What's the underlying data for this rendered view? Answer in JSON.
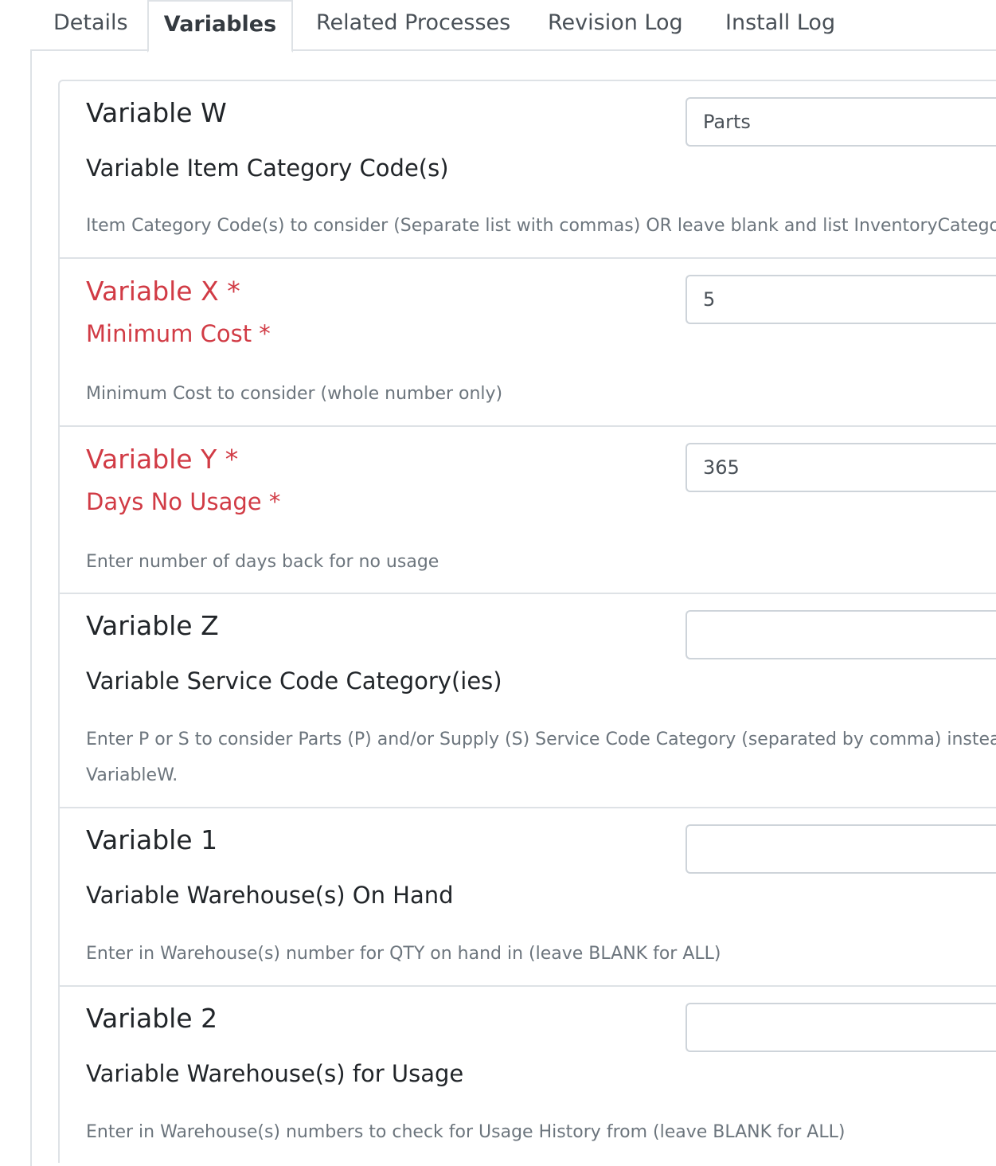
{
  "tabs": [
    {
      "label": "Details",
      "active": false
    },
    {
      "label": "Variables",
      "active": true
    },
    {
      "label": "Related Processes",
      "active": false
    },
    {
      "label": "Revision Log",
      "active": false
    },
    {
      "label": "Install Log",
      "active": false
    }
  ],
  "variables": [
    {
      "title": "Variable W",
      "subtitle": "Variable Item Category Code(s)",
      "description": "Item Category Code(s) to consider (Separate list with commas) OR leave blank and list InventoryCategoryCod",
      "value": "Parts",
      "required": false
    },
    {
      "title": "Variable X *",
      "subtitle": "Minimum Cost *",
      "description": "Minimum Cost to consider (whole number only)",
      "value": "5",
      "required": true
    },
    {
      "title": "Variable Y *",
      "subtitle": "Days No Usage *",
      "description": "Enter number of days back for no usage",
      "value": "365",
      "required": true
    },
    {
      "title": "Variable Z",
      "subtitle": "Variable Service Code Category(ies)",
      "description_line1": "Enter P or S to consider Parts (P) and/or Supply (S) Service Code Category (separated by comma) instead of I",
      "description_line2": "VariableW.",
      "value": "",
      "required": false
    },
    {
      "title": "Variable 1",
      "subtitle": "Variable Warehouse(s) On Hand",
      "description": "Enter in Warehouse(s) number for QTY on hand in (leave BLANK for ALL)",
      "value": "",
      "required": false
    },
    {
      "title": "Variable 2",
      "subtitle": "Variable Warehouse(s) for Usage",
      "description": "Enter in Warehouse(s) numbers to check for Usage History from (leave BLANK for ALL)",
      "value": "",
      "required": false
    }
  ],
  "colors": {
    "required": "#d13b45",
    "border": "#dee2e6",
    "muted": "#6c757d"
  }
}
